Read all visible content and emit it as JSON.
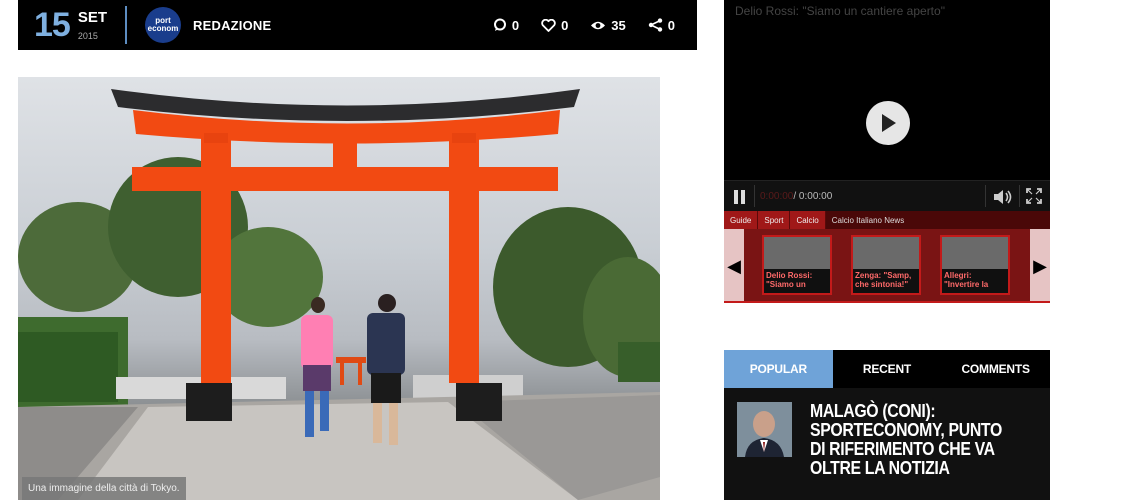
{
  "article_meta": {
    "day": "15",
    "month": "SET",
    "year": "2015",
    "author_logo_line1": "port",
    "author_logo_line2": "econom",
    "author": "REDAZIONE",
    "stats": {
      "comments": "0",
      "likes": "0",
      "views": "35",
      "shares": "0"
    }
  },
  "hero": {
    "caption": "Una immagine della città di Tokyo."
  },
  "video": {
    "title": "Delio Rossi: \"Siamo un cantiere aperto\"",
    "time_current": "0:00:00",
    "time_total": "/ 0:00:00",
    "breadcrumbs": [
      "Guide",
      "Sport",
      "Calcio"
    ],
    "breadcrumb_title": "Calcio Italiano News",
    "related": [
      {
        "label": "Delio Rossi: \"Siamo un"
      },
      {
        "label": "Zenga: \"Samp, che sintonia!\""
      },
      {
        "label": "Allegri: \"Invertire la"
      }
    ]
  },
  "tabs_widget": {
    "tabs": [
      "POPULAR",
      "RECENT",
      "COMMENTS"
    ],
    "active_tab": "POPULAR",
    "post_title": "MALAGÒ (CONI): SPORTECONOMY, PUNTO DI RIFERIMENTO CHE VA OLTRE LA NOTIZIA"
  },
  "colors": {
    "accent_blue": "#6fa3d8",
    "torii_red": "#f24a12",
    "video_red": "#c31a1a"
  }
}
